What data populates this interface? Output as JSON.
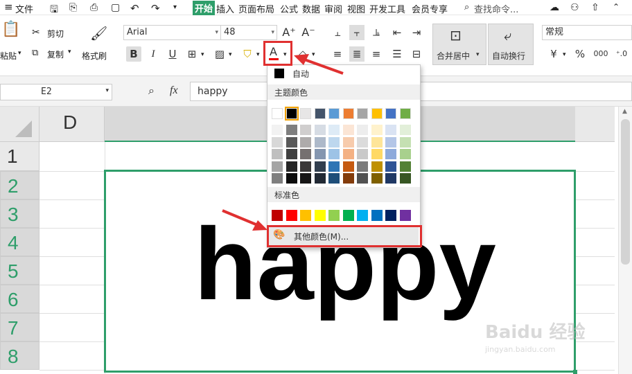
{
  "menubar": {
    "file_label": "文件",
    "tabs": [
      "开始",
      "插入",
      "页面布局",
      "公式",
      "数据",
      "审阅",
      "视图",
      "开发工具",
      "会员专享"
    ],
    "search_placeholder": "查找命令..."
  },
  "ribbon": {
    "paste_label": "粘贴",
    "cut_label": "剪切",
    "copy_label": "复制",
    "format_painter_label": "格式刷",
    "font_name": "Arial",
    "font_size": "48",
    "merge_center_label": "合并居中",
    "wrap_text_label": "自动换行",
    "number_format": "常规"
  },
  "formula_bar": {
    "cell_ref": "E2",
    "fx_label": "fx",
    "content": "happy"
  },
  "sheet": {
    "column_header": "D",
    "row_numbers": [
      "1",
      "2",
      "3",
      "4",
      "5",
      "6",
      "7",
      "8"
    ],
    "cell_text": "happy"
  },
  "color_menu": {
    "auto_label": "自动",
    "theme_label": "主题颜色",
    "standard_label": "标准色",
    "more_colors_label": "其他颜色(M)...",
    "theme_top_row": [
      "#ffffff",
      "#000000",
      "#e7e6e6",
      "#44546a",
      "#5b9bd5",
      "#ed7d31",
      "#a5a5a5",
      "#ffc000",
      "#4472c4",
      "#70ad47"
    ],
    "theme_shades": [
      [
        "#f2f2f2",
        "#7f7f7f",
        "#d0cece",
        "#d6dce4",
        "#deebf6",
        "#fbe5d5",
        "#ededed",
        "#fff2cc",
        "#dae3f3",
        "#e2efd9"
      ],
      [
        "#d8d8d8",
        "#595959",
        "#aeabab",
        "#adb9ca",
        "#bdd7ee",
        "#f7cbac",
        "#dbdbdb",
        "#fee599",
        "#b4c6e7",
        "#c5e0b3"
      ],
      [
        "#bfbfbf",
        "#3f3f3f",
        "#757070",
        "#8496b0",
        "#9dc3e6",
        "#f4b183",
        "#c9c9c9",
        "#ffd965",
        "#8eaadb",
        "#a8d08d"
      ],
      [
        "#a5a5a5",
        "#262626",
        "#3a3838",
        "#323f4f",
        "#2e75b5",
        "#c55a11",
        "#7b7b7b",
        "#bf9000",
        "#2f5496",
        "#538135"
      ],
      [
        "#7f7f7f",
        "#0c0c0c",
        "#171616",
        "#222a35",
        "#1e4e79",
        "#833c0b",
        "#525252",
        "#7f6000",
        "#1f3864",
        "#375623"
      ]
    ],
    "standard_colors": [
      "#c00000",
      "#ff0000",
      "#ffc000",
      "#ffff00",
      "#92d050",
      "#00b050",
      "#00b0f0",
      "#0070c0",
      "#002060",
      "#7030a0"
    ]
  },
  "watermark": {
    "brand": "Baidu 经验",
    "url": "jingyan.baidu.com"
  },
  "colors": {
    "accent_green": "#2e9e6a",
    "highlight_red": "#e03030",
    "header_gray": "#d9d9d9"
  }
}
